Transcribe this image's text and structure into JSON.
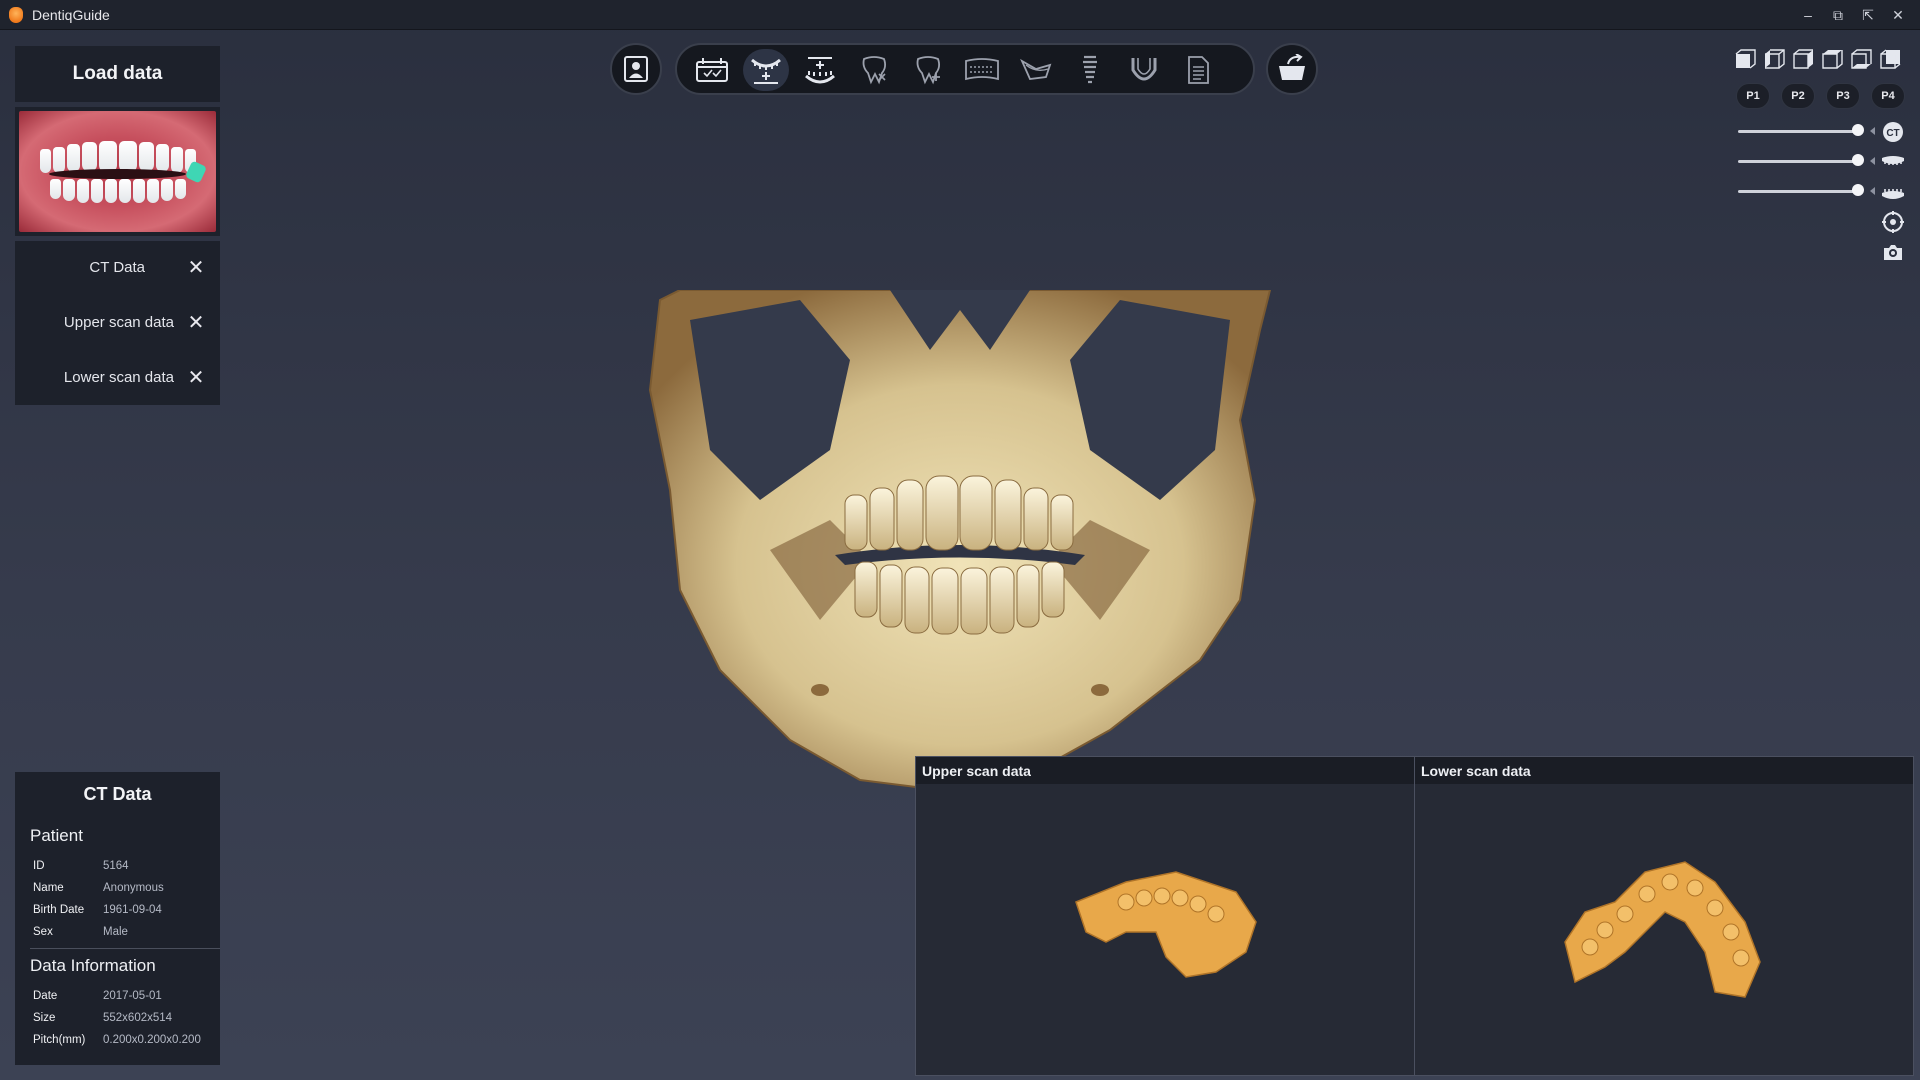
{
  "app": {
    "title": "DentiqGuide"
  },
  "window_controls": {
    "minimize": "–",
    "restore": "⧉",
    "detach": "⇱",
    "close": "✕"
  },
  "left_panel": {
    "load_title": "Load data",
    "data_items": [
      {
        "label": "CT Data",
        "remove": "✕"
      },
      {
        "label": "Upper scan data",
        "remove": "✕"
      },
      {
        "label": "Lower scan data",
        "remove": "✕"
      }
    ]
  },
  "ct_info": {
    "title": "CT Data",
    "patient_heading": "Patient",
    "patient": [
      {
        "key": "ID",
        "value": "5164"
      },
      {
        "key": "Name",
        "value": "Anonymous"
      },
      {
        "key": "Birth Date",
        "value": "1961-09-04"
      },
      {
        "key": "Sex",
        "value": "Male"
      }
    ],
    "data_heading": "Data Information",
    "data": [
      {
        "key": "Date",
        "value": "2017-05-01"
      },
      {
        "key": "Size",
        "value": "552x602x514"
      },
      {
        "key": "Pitch(mm)",
        "value": "0.200x0.200x0.200"
      }
    ]
  },
  "toolbar": {
    "icons": [
      "patient-icon",
      "planning-icon",
      "upper-scan-icon",
      "lower-scan-icon",
      "tooth-icon",
      "tooth-plus-icon",
      "panorama-icon",
      "nerve-icon",
      "implant-icon",
      "guide-arch-icon",
      "report-icon",
      "export-icon"
    ],
    "active_tool": "upper-scan-icon"
  },
  "right_controls": {
    "presets": [
      "P1",
      "P2",
      "P3",
      "P4"
    ],
    "slider_labels": {
      "ct": "CT"
    },
    "slider_levels": [
      1.0,
      1.0,
      1.0
    ]
  },
  "scan_panes": {
    "upper_title": "Upper scan data",
    "lower_title": "Lower scan data"
  },
  "colors": {
    "bone": "#d8c594",
    "scan_model": "#e8a84a",
    "background_top": "#2a2f3e",
    "background_bottom": "#3c4254",
    "panel": "#1d212b"
  }
}
